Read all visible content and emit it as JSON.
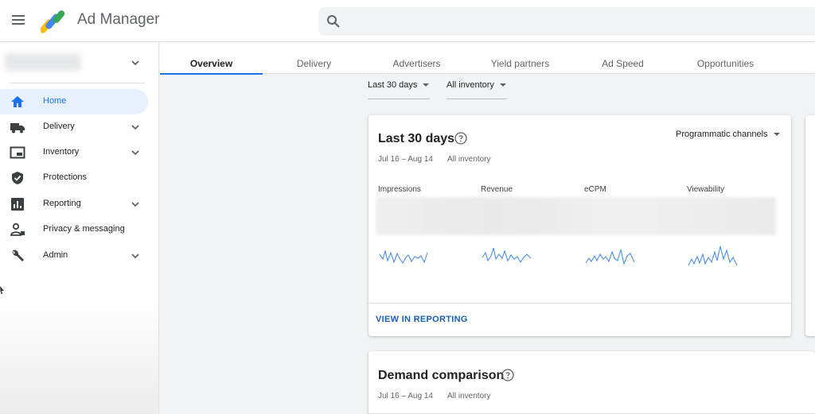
{
  "app": {
    "title": "Ad Manager"
  },
  "search": {
    "placeholder": ""
  },
  "sidebar": {
    "items": [
      {
        "label": "Home",
        "icon": "home-icon",
        "active": true,
        "expandable": false
      },
      {
        "label": "Delivery",
        "icon": "truck-icon",
        "active": false,
        "expandable": true
      },
      {
        "label": "Inventory",
        "icon": "inventory-icon",
        "active": false,
        "expandable": true
      },
      {
        "label": "Protections",
        "icon": "shield-icon",
        "active": false,
        "expandable": false
      },
      {
        "label": "Reporting",
        "icon": "bar-chart-icon",
        "active": false,
        "expandable": true
      },
      {
        "label": "Privacy & messaging",
        "icon": "person-privacy-icon",
        "active": false,
        "expandable": false
      },
      {
        "label": "Admin",
        "icon": "wrench-icon",
        "active": false,
        "expandable": true
      }
    ]
  },
  "tabs": [
    {
      "label": "Overview",
      "active": true
    },
    {
      "label": "Delivery",
      "active": false
    },
    {
      "label": "Advertisers",
      "active": false
    },
    {
      "label": "Yield partners",
      "active": false
    },
    {
      "label": "Ad Speed",
      "active": false
    },
    {
      "label": "Opportunities",
      "active": false
    }
  ],
  "filters": {
    "date": "Last 30 days",
    "inventory": "All inventory"
  },
  "summary_card": {
    "title": "Last 30 days",
    "date_range": "Jul 16 – Aug 14",
    "inventory": "All inventory",
    "channel_select": "Programmatic channels",
    "metrics": [
      "Impressions",
      "Revenue",
      "eCPM",
      "Viewability"
    ],
    "link": "VIEW IN REPORTING"
  },
  "demand_card": {
    "title": "Demand comparison",
    "date_range": "Jul 16 – Aug 14",
    "inventory": "All inventory"
  },
  "colors": {
    "accent": "#1a73e8",
    "link": "#1a5fb4",
    "spark": "#4a8fe0"
  }
}
